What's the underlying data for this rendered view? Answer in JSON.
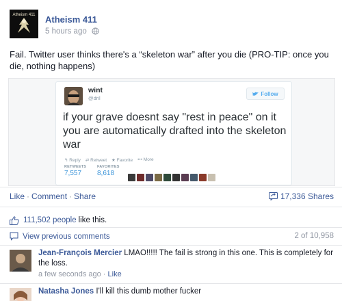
{
  "post": {
    "page_name": "Atheism 411",
    "avatar_logo_text": "Atheism 411",
    "time": "5 hours ago",
    "text": "Fail. Twitter user thinks there's a “skeleton war” after you die (PRO-TIP: once you die, nothing happens)"
  },
  "tweet": {
    "name": "wint",
    "handle": "@dril",
    "follow_label": "Follow",
    "text": "if your grave doesnt say \"rest in peace\" on it you are automatically drafted into the skeleton war",
    "actions": [
      "Reply",
      "Retweet",
      "Favorite",
      "More"
    ],
    "retweets_label": "RETWEETS",
    "retweets_value": "7,557",
    "favorites_label": "FAVORITES",
    "favorites_value": "8,618"
  },
  "actions": {
    "like": "Like",
    "comment": "Comment",
    "share": "Share",
    "shares_count": "17,336 Shares"
  },
  "likes": {
    "count": "111,502 people",
    "rest": "like this."
  },
  "comments_header": {
    "view_previous": "View previous comments",
    "count": "2 of 10,958"
  },
  "comments": [
    {
      "author": "Jean-François Mercier",
      "text": "LMAO!!!!! The fail is strong in this one. This is completely for the loss.",
      "time": "a few seconds ago",
      "like": "Like"
    },
    {
      "author": "Natasha Jones",
      "text": "I'll kill this dumb mother fucker"
    }
  ],
  "colors": {
    "link": "#3b5998",
    "muted": "#9197a3",
    "twitter_blue": "#55acee"
  }
}
